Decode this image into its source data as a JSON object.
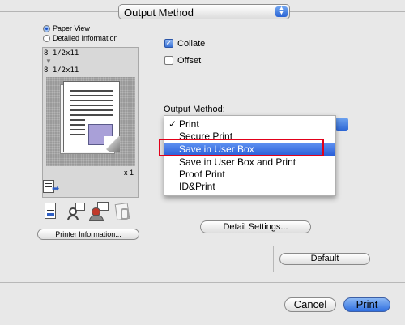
{
  "top_popup": {
    "label": "Output Method"
  },
  "left_panel": {
    "view_options": [
      {
        "label": "Paper View",
        "selected": true
      },
      {
        "label": "Detailed Information",
        "selected": false
      }
    ],
    "paper_size_top": "8 1/2x11",
    "paper_size_bottom": "8 1/2x11",
    "copies": "x 1",
    "printer_information_button": "Printer Information..."
  },
  "right_panel": {
    "collate": {
      "label": "Collate",
      "checked": true
    },
    "offset": {
      "label": "Offset",
      "checked": false
    },
    "output_method_label": "Output Method:",
    "output_method_options": [
      {
        "label": "Print",
        "checked": true,
        "highlighted": false
      },
      {
        "label": "Secure Print",
        "checked": false,
        "highlighted": false
      },
      {
        "label": "Save in User Box",
        "checked": false,
        "highlighted": true
      },
      {
        "label": "Save in User Box and Print",
        "checked": false,
        "highlighted": false
      },
      {
        "label": "Proof Print",
        "checked": false,
        "highlighted": false
      },
      {
        "label": "ID&Print",
        "checked": false,
        "highlighted": false
      }
    ],
    "detail_settings_button": "Detail Settings...",
    "default_button": "Default"
  },
  "footer": {
    "cancel_button": "Cancel",
    "print_button": "Print"
  },
  "colors": {
    "highlight": "#2a5fd8",
    "annotation_red": "#e2001a"
  }
}
